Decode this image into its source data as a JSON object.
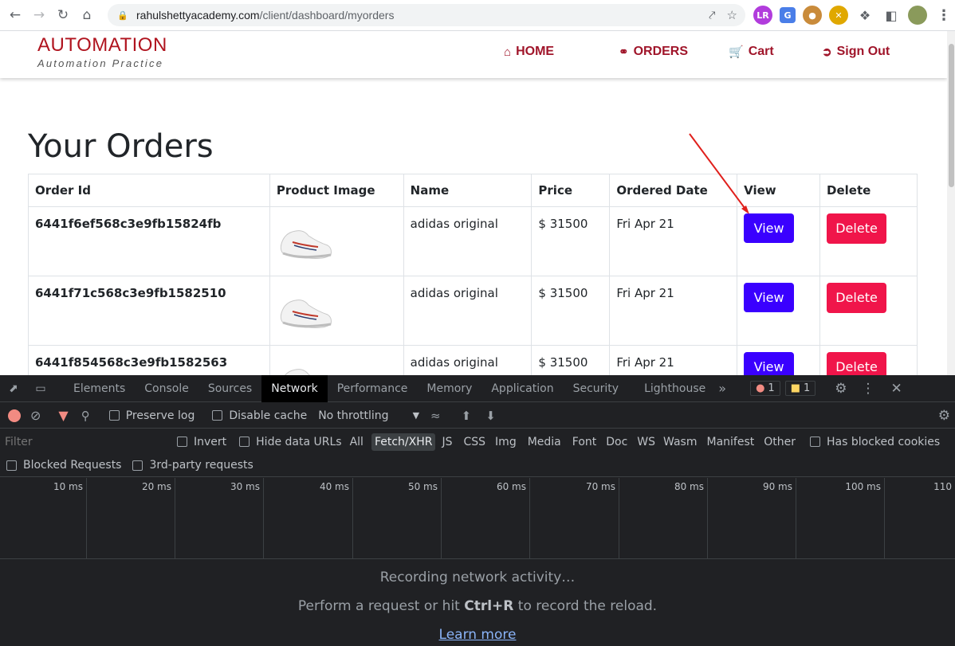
{
  "browser": {
    "url_host": "rahulshettyacademy.com",
    "url_path": "/client/dashboard/myorders"
  },
  "site": {
    "brand_title": "AUTOMATION",
    "brand_subtitle": "Automation Practice",
    "menu": {
      "home": "HOME",
      "orders": "ORDERS",
      "cart": "Cart",
      "signout": "Sign Out"
    },
    "heading": "Your Orders"
  },
  "table": {
    "headers": [
      "Order Id",
      "Product Image",
      "Name",
      "Price",
      "Ordered Date",
      "View",
      "Delete"
    ],
    "rows": [
      {
        "order_id": "6441f6ef568c3e9fb15824fb",
        "name": "adidas original",
        "price": "$ 31500",
        "date": "Fri Apr 21",
        "view": "View",
        "delete": "Delete"
      },
      {
        "order_id": "6441f71c568c3e9fb1582510",
        "name": "adidas original",
        "price": "$ 31500",
        "date": "Fri Apr 21",
        "view": "View",
        "delete": "Delete"
      },
      {
        "order_id": "6441f854568c3e9fb1582563",
        "name": "adidas original",
        "price": "$ 31500",
        "date": "Fri Apr 21",
        "view": "View",
        "delete": "Delete"
      }
    ]
  },
  "devtools": {
    "tabs": [
      "Elements",
      "Console",
      "Sources",
      "Network",
      "Performance",
      "Memory",
      "Application",
      "Security",
      "Lighthouse"
    ],
    "active_tab": "Network",
    "error_count": "1",
    "warning_count": "1",
    "toolbar": {
      "preserve_log": "Preserve log",
      "disable_cache": "Disable cache",
      "throttling": "No throttling"
    },
    "filter": {
      "placeholder": "Filter",
      "invert": "Invert",
      "hide_data_urls": "Hide data URLs",
      "types": [
        "All",
        "Fetch/XHR",
        "JS",
        "CSS",
        "Img",
        "Media",
        "Font",
        "Doc",
        "WS",
        "Wasm",
        "Manifest",
        "Other"
      ],
      "selected_type": "Fetch/XHR",
      "has_blocked_cookies": "Has blocked cookies",
      "blocked_requests": "Blocked Requests",
      "third_party": "3rd-party requests"
    },
    "timeline_ticks": [
      "10 ms",
      "20 ms",
      "30 ms",
      "40 ms",
      "50 ms",
      "60 ms",
      "70 ms",
      "80 ms",
      "90 ms",
      "100 ms",
      "110"
    ],
    "empty": {
      "line1": "Recording network activity…",
      "line2_pre": "Perform a request or hit ",
      "line2_key": "Ctrl+R",
      "line2_post": " to record the reload.",
      "learn_more": "Learn more"
    }
  },
  "colors": {
    "brand": "#b0141f",
    "view_button": "#3a00ff",
    "delete_button": "#f0154a",
    "devtools_bg": "#202124"
  }
}
